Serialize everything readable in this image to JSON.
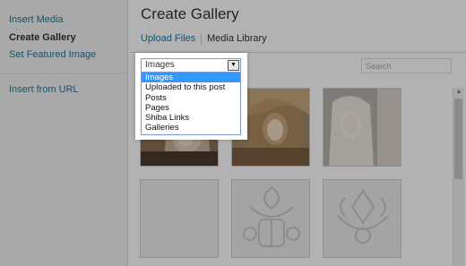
{
  "sidebar": {
    "items": [
      {
        "label": "Insert Media",
        "active": false
      },
      {
        "label": "Create Gallery",
        "active": true
      },
      {
        "label": "Set Featured Image",
        "active": false
      },
      {
        "label": "Insert from URL",
        "active": false
      }
    ]
  },
  "main": {
    "title": "Create Gallery",
    "tabs": [
      {
        "label": "Upload Files"
      },
      {
        "label": "Media Library"
      }
    ],
    "filter": {
      "selected": "Images",
      "options": [
        "Images",
        "Uploaded to this post",
        "Posts",
        "Pages",
        "Shiba Links",
        "Galleries"
      ]
    },
    "search": {
      "placeholder": "Search"
    }
  },
  "colors": {
    "link": "#21759b",
    "selected_option": "#3399ff",
    "overlay": "rgba(0,0,0,0.30)"
  }
}
